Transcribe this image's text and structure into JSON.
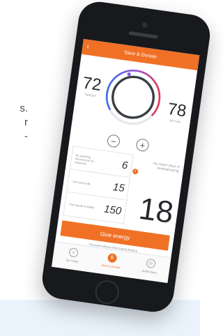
{
  "page": {
    "background_color": "#ffffff",
    "band_color": "#eaf3fb",
    "peek_lines": [
      "s.",
      "r",
      "-"
    ]
  },
  "app": {
    "accent_color": "#f07126",
    "header": {
      "title": "Save & Donate",
      "back_icon": "chevron-left-icon"
    },
    "dial": {
      "target_value": "72",
      "target_label": "TARGET",
      "actual_value": "78",
      "actual_label": "ACTUAL",
      "gradient_colors": [
        "#3d6ff2",
        "#9a4fd8",
        "#e8354c"
      ]
    },
    "controls": {
      "minus_icon": "minus-icon",
      "plus_icon": "plus-icon"
    },
    "stats": [
      {
        "label": "By adjusting temperature by (degrees)",
        "value": "6"
      },
      {
        "label": "I am saving ($)",
        "value": "15"
      },
      {
        "label": "That equals to (kWh)",
        "value": "150"
      }
    ],
    "impact": {
      "label": "My impact (days of heating/cooling)",
      "value": "18",
      "info_icon": "info-icon"
    },
    "give_button_label": "Give energy",
    "proceed_label": "Proceed without thermostat feature",
    "tabs": [
      {
        "label": "My Profile",
        "icon": "user-icon",
        "active": false
      },
      {
        "label": "Save & Donate",
        "icon": "dollar-icon",
        "active": true
      },
      {
        "label": "Notifications",
        "icon": "bell-icon",
        "active": false
      }
    ]
  }
}
